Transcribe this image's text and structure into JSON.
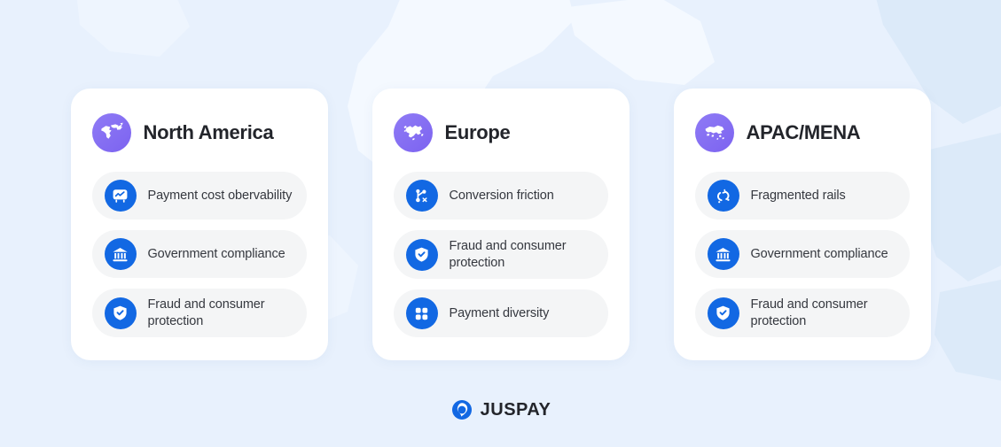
{
  "theme": {
    "background_color": "#e8f1fd",
    "card_background": "#ffffff",
    "pill_background": "#f4f5f6",
    "region_icon_color": "#7c63f0",
    "item_icon_color": "#1268e3",
    "title_color": "#23252b",
    "label_color": "#35383f"
  },
  "cards": [
    {
      "title": "North America",
      "region_icon": "north-america-map-icon",
      "items": [
        {
          "label": "Payment cost obervability",
          "icon": "analytics-board-icon"
        },
        {
          "label": "Government compliance",
          "icon": "bank-building-icon"
        },
        {
          "label": "Fraud and consumer protection",
          "icon": "shield-check-icon"
        }
      ]
    },
    {
      "title": "Europe",
      "region_icon": "europe-map-icon",
      "items": [
        {
          "label": "Conversion friction",
          "icon": "branching-flow-x-icon"
        },
        {
          "label": "Fraud and consumer protection",
          "icon": "shield-check-icon"
        },
        {
          "label": "Payment diversity",
          "icon": "grid-four-squares-icon"
        }
      ]
    },
    {
      "title": "APAC/MENA",
      "region_icon": "apac-mena-map-icon",
      "items": [
        {
          "label": "Fragmented rails",
          "icon": "broken-link-icon"
        },
        {
          "label": "Government compliance",
          "icon": "bank-building-icon"
        },
        {
          "label": "Fraud and consumer protection",
          "icon": "shield-check-icon"
        }
      ]
    }
  ],
  "brand": {
    "name": "JUSPAY",
    "mark_icon": "juspay-logo-icon"
  }
}
